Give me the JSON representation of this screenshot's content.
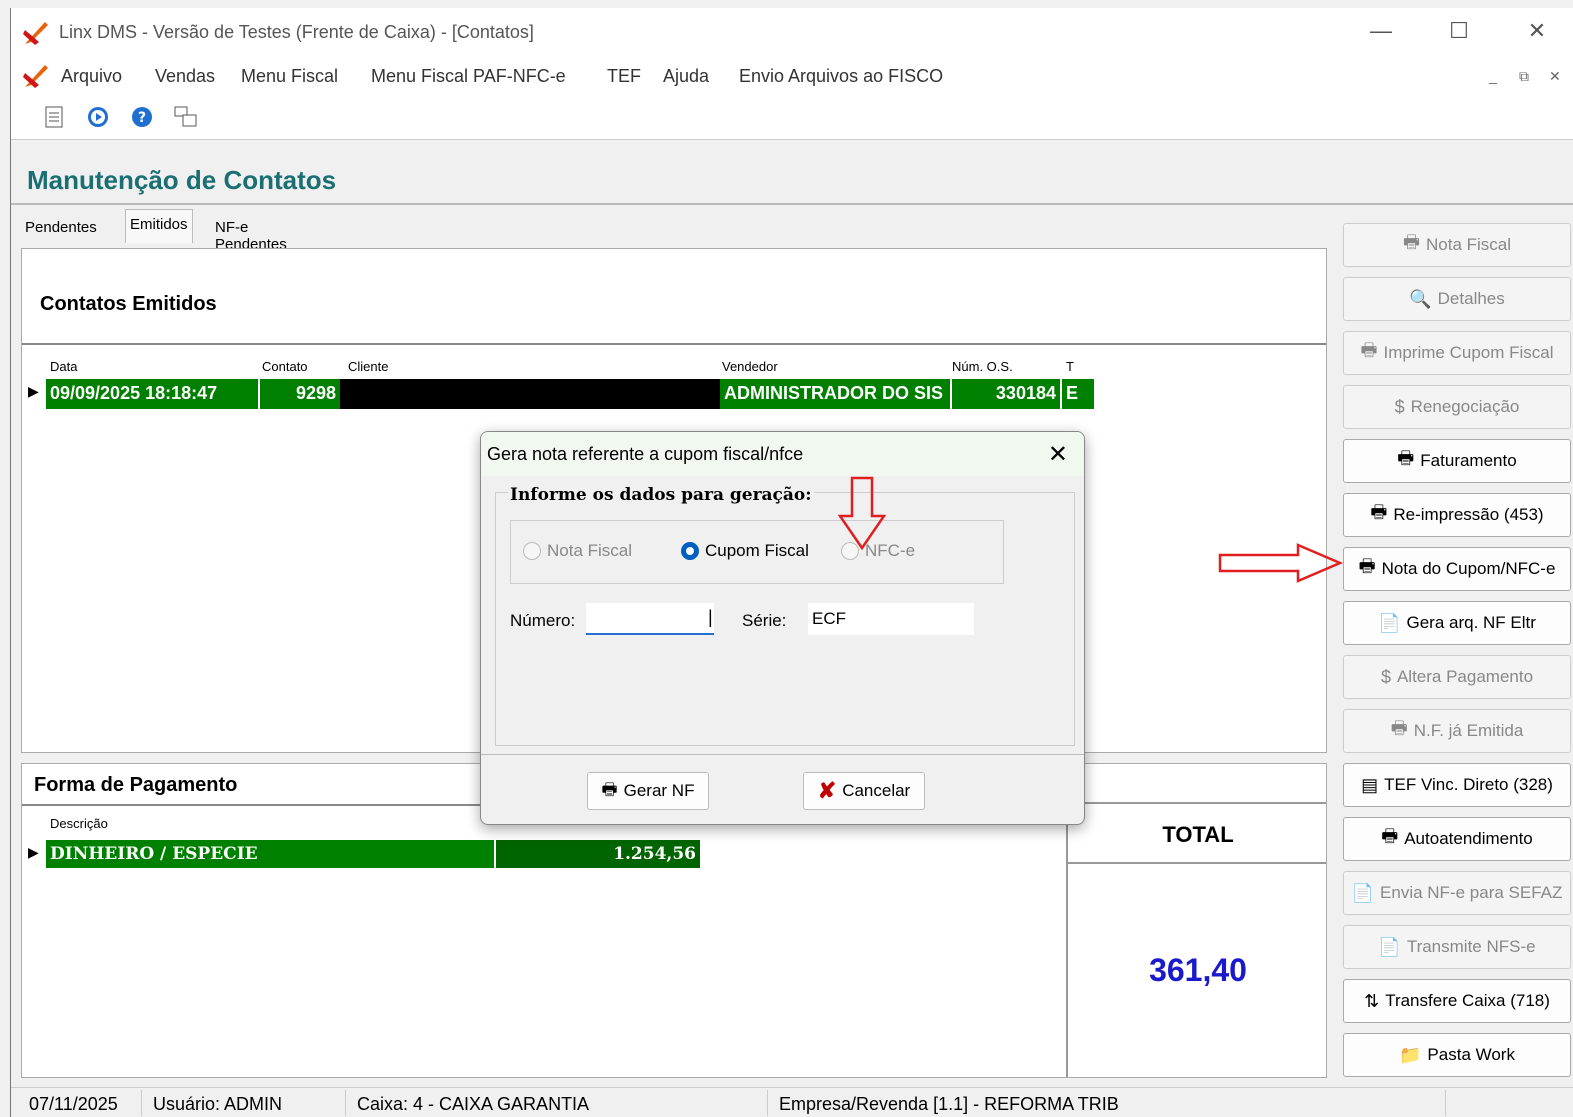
{
  "window": {
    "title": "Linx DMS - Versão de Testes (Frente de Caixa) - [Contatos]",
    "minimize": "—",
    "maximize": "☐",
    "close": "✕"
  },
  "menu": [
    "Arquivo",
    "Vendas",
    "Menu Fiscal",
    "Menu Fiscal PAF-NFC-e",
    "TEF",
    "Ajuda",
    "Envio Arquivos ao FISCO"
  ],
  "page_title": "Manutenção de Contatos",
  "tabs": [
    "Pendentes",
    "Emitidos",
    "NF-e Pendentes"
  ],
  "emitidos": {
    "section_title": "Contatos Emitidos",
    "columns": [
      "Data",
      "Contato",
      "Cliente",
      "Vendedor",
      "Núm. O.S.",
      "T"
    ],
    "rows": [
      {
        "data": "09/09/2025 18:18:47",
        "contato": "9298",
        "cliente": "",
        "vendedor": "ADMINISTRADOR DO SIS",
        "num_os": "330184",
        "t": "E"
      }
    ]
  },
  "pagamento": {
    "section_title": "Forma de Pagamento",
    "columns": [
      "Descrição"
    ],
    "rows": [
      {
        "descricao": "DINHEIRO / ESPECIE",
        "valor": "1.254,56"
      }
    ],
    "total_label": "TOTAL",
    "total_value": "361,40"
  },
  "sidebar": [
    {
      "label": "Nota Fiscal",
      "icon": "🖶",
      "enabled": false
    },
    {
      "label": "Detalhes",
      "icon": "🔍",
      "enabled": false
    },
    {
      "label": "Imprime Cupom Fiscal",
      "icon": "🖶",
      "enabled": false
    },
    {
      "label": "Renegociação",
      "icon": "$",
      "enabled": false
    },
    {
      "label": "Faturamento",
      "icon": "🖶",
      "enabled": true
    },
    {
      "label": "Re-impressão (453)",
      "icon": "🖶",
      "enabled": true
    },
    {
      "label": "Nota do Cupom/NFC-e",
      "icon": "🖶",
      "enabled": true
    },
    {
      "label": "Gera arq. NF Eltr",
      "icon": "📄",
      "enabled": true
    },
    {
      "label": "Altera Pagamento",
      "icon": "$",
      "enabled": false
    },
    {
      "label": "N.F. já Emitida",
      "icon": "🖶",
      "enabled": false
    },
    {
      "label": "TEF Vinc. Direto (328)",
      "icon": "▤",
      "enabled": true
    },
    {
      "label": "Autoatendimento",
      "icon": "🖶",
      "enabled": true
    },
    {
      "label": "Envia NF-e para SEFAZ",
      "icon": "📄",
      "enabled": false
    },
    {
      "label": "Transmite NFS-e",
      "icon": "📄",
      "enabled": false
    },
    {
      "label": "Transfere Caixa (718)",
      "icon": "⇅",
      "enabled": true
    },
    {
      "label": "Pasta Work",
      "icon": "📁",
      "enabled": true
    }
  ],
  "status": {
    "date": "07/11/2025",
    "user": "Usuário: ADMIN",
    "caixa": "Caixa: 4 - CAIXA GARANTIA",
    "empresa": "Empresa/Revenda [1.1] - REFORMA TRIB"
  },
  "dialog": {
    "title": "Gera nota referente a cupom fiscal/nfce",
    "group_title": "Informe os dados para geração:",
    "radio_nota_fiscal": "Nota Fiscal",
    "radio_cupom_fiscal": "Cupom Fiscal",
    "radio_nfce": "NFC-e",
    "numero_label": "Número:",
    "numero_value": "",
    "serie_label": "Série:",
    "serie_value": "ECF",
    "gerar_label": "Gerar NF",
    "cancelar_label": "Cancelar"
  },
  "colors": {
    "row_green": "#008000",
    "title_teal": "#1a6f73",
    "total_blue": "#1a1acc",
    "arrow_red": "#e02020"
  }
}
